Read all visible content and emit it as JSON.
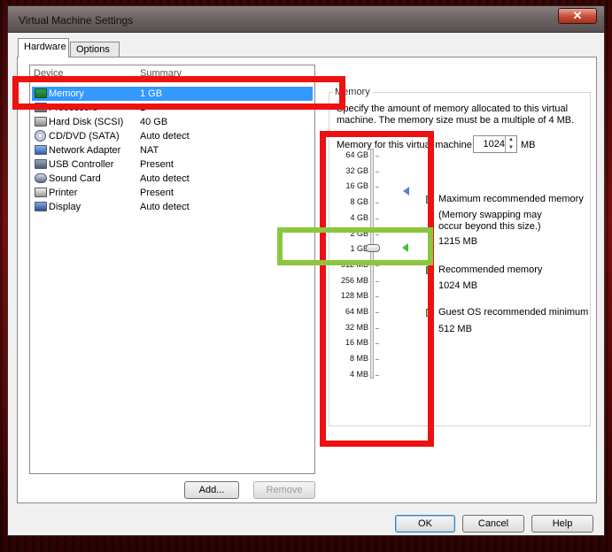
{
  "window": {
    "title": "Virtual Machine Settings",
    "close_glyph": "✕"
  },
  "tabs": [
    {
      "label": "Hardware",
      "active": true
    },
    {
      "label": "Options",
      "active": false
    }
  ],
  "device_list": {
    "headers": {
      "device": "Device",
      "summary": "Summary"
    },
    "items": [
      {
        "name": "Memory",
        "summary": "1 GB",
        "icon": "memory-icon",
        "selected": true
      },
      {
        "name": "Processors",
        "summary": "1",
        "icon": "processor-icon",
        "selected": false
      },
      {
        "name": "Hard Disk (SCSI)",
        "summary": "40 GB",
        "icon": "hard-disk-icon",
        "selected": false
      },
      {
        "name": "CD/DVD (SATA)",
        "summary": "Auto detect",
        "icon": "cd-dvd-icon",
        "selected": false
      },
      {
        "name": "Network Adapter",
        "summary": "NAT",
        "icon": "network-adapter-icon",
        "selected": false
      },
      {
        "name": "USB Controller",
        "summary": "Present",
        "icon": "usb-icon",
        "selected": false
      },
      {
        "name": "Sound Card",
        "summary": "Auto detect",
        "icon": "sound-card-icon",
        "selected": false
      },
      {
        "name": "Printer",
        "summary": "Present",
        "icon": "printer-icon",
        "selected": false
      },
      {
        "name": "Display",
        "summary": "Auto detect",
        "icon": "display-icon",
        "selected": false
      }
    ]
  },
  "buttons": {
    "add": "Add...",
    "remove": "Remove",
    "ok": "OK",
    "cancel": "Cancel",
    "help": "Help"
  },
  "memory": {
    "group_label": "Memory",
    "description": "Specify the amount of memory allocated to this virtual machine. The memory size must be a multiple of 4 MB.",
    "field_label": "Memory for this virtual machine:",
    "value": "1024",
    "unit": "MB",
    "scale": [
      "64 GB",
      "32 GB",
      "16 GB",
      "8 GB",
      "4 GB",
      "2 GB",
      "1 GB",
      "512 MB",
      "256 MB",
      "128 MB",
      "64 MB",
      "32 MB",
      "16 MB",
      "8 MB",
      "4 MB"
    ],
    "legend": {
      "max_title": "Maximum recommended memory",
      "max_note": "(Memory swapping may occur beyond this size.)",
      "max_value": "1215 MB",
      "rec_title": "Recommended memory",
      "rec_value": "1024 MB",
      "min_title": "Guest OS recommended minimum",
      "min_value": "512 MB"
    }
  },
  "colors": {
    "selection": "#3399ff",
    "max_marker": "#5b7fd6",
    "rec_marker": "#3fbf3f",
    "min_marker": "#e8d840",
    "annotation_red": "#ee1111",
    "annotation_green": "#8cc63f"
  }
}
